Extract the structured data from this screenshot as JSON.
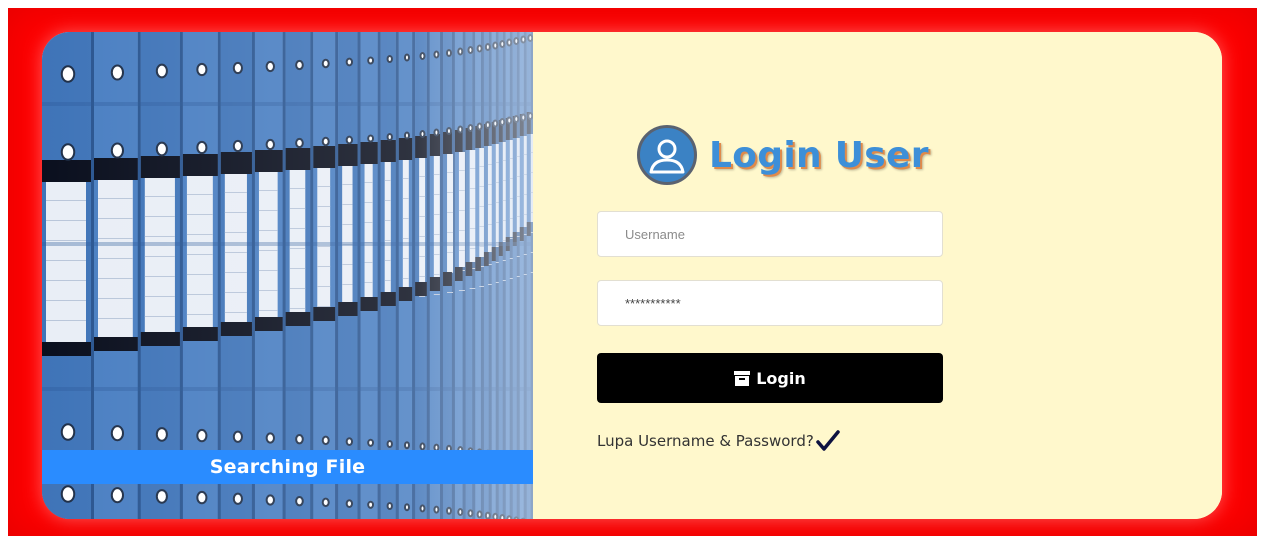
{
  "hero": {
    "banner_label": "Searching File"
  },
  "login": {
    "title": "Login User",
    "username_placeholder": "Username",
    "password_value": "***********",
    "button_label": "Login",
    "forgot_label": "Lupa Username & Password?"
  },
  "icons": {
    "user": "user-circle-icon",
    "button": "archive-box-icon",
    "forgot": "check-icon"
  },
  "colors": {
    "frame": "#ff0000",
    "card": "#fff8cc",
    "banner": "#2a8cff",
    "title": "#3d8fd8",
    "button": "#000000"
  }
}
